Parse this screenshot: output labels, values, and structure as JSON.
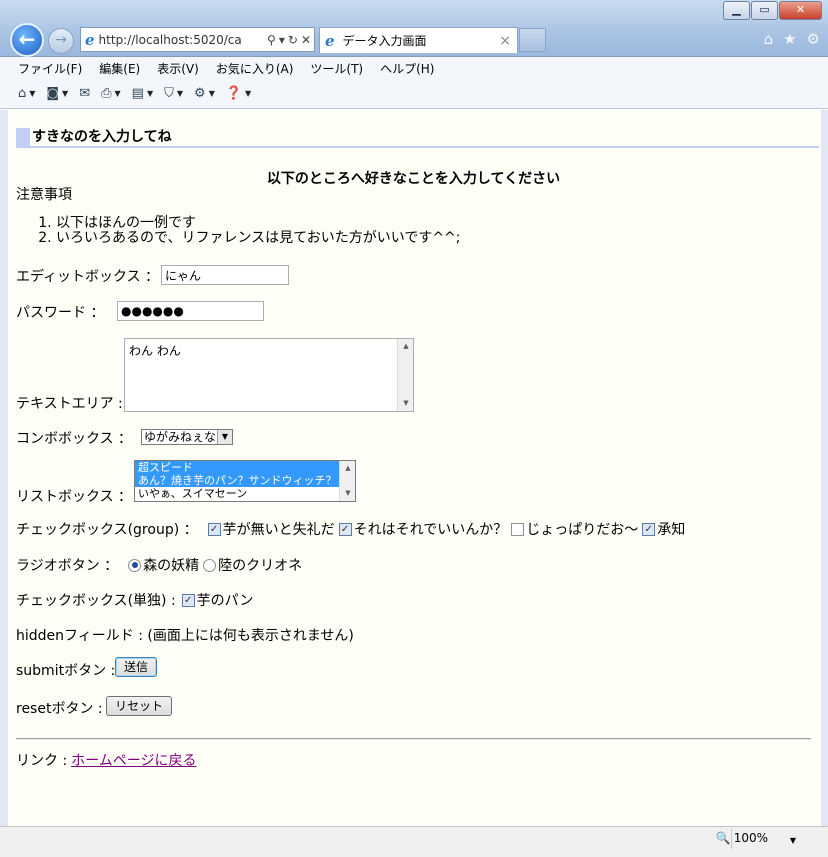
{
  "browser": {
    "address": "http://localhost:5020/ca",
    "tab_title": "データ入力画面",
    "tab_close": "×",
    "zoom": "100%"
  },
  "menu": [
    "ファイル(F)",
    "編集(E)",
    "表示(V)",
    "お気に入り(A)",
    "ツール(T)",
    "ヘルプ(H)"
  ],
  "page": {
    "heading": "すきなのを入力してね",
    "center_title": "以下のところへ好きなことを入力してください",
    "notes_label": "注意事項",
    "notes": [
      "以下はほんの一例です",
      "いろいろあるので、リファレンスは見ておいた方がいいです^^;"
    ],
    "editbox": {
      "label": "エディットボックス ：",
      "value": "にゃん"
    },
    "password": {
      "label": "パスワード ：",
      "value": "●●●●●●"
    },
    "textarea": {
      "label": "テキストエリア :",
      "value": "わん わん"
    },
    "combo": {
      "label": "コンボボックス ：",
      "value": "ゆがみねぇな"
    },
    "listbox": {
      "label": "リストボックス ：",
      "options": [
        {
          "text": "超スピード",
          "selected": true
        },
        {
          "text": "あん？焼き芋のパン？サンドウィッチ？",
          "selected": true
        },
        {
          "text": "いやぁ、スイマセーン",
          "selected": false
        }
      ]
    },
    "checkgroup": {
      "label": "チェックボックス(group) ：",
      "items": [
        {
          "text": "芋が無いと失礼だ",
          "checked": true
        },
        {
          "text": "それはそれでいいんか？",
          "checked": true
        },
        {
          "text": "じょっぱりだお～",
          "checked": false
        },
        {
          "text": "承知",
          "checked": true
        }
      ]
    },
    "radio": {
      "label": "ラジオボタン ：",
      "items": [
        {
          "text": "森の妖精",
          "checked": true
        },
        {
          "text": "陸のクリオネ",
          "checked": false
        }
      ]
    },
    "checksingle": {
      "label": "チェックボックス(単独) :",
      "text": "芋のパン",
      "checked": true
    },
    "hidden": {
      "label": "hiddenフィールド : (画面上には何も表示されません)"
    },
    "submit": {
      "label": "submitボタン :",
      "button": "送信"
    },
    "reset": {
      "label": "resetボタン :",
      "button": "リセット"
    },
    "link": {
      "label": "リンク :",
      "text": "ホームページに戻る"
    }
  }
}
